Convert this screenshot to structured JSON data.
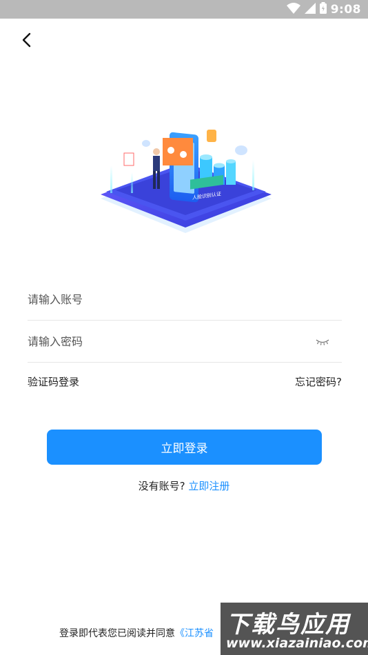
{
  "status_bar": {
    "time": "9:08",
    "icons": [
      "wifi-icon",
      "signal-icon",
      "battery-icon"
    ]
  },
  "nav": {
    "back_icon": "chevron-left-icon"
  },
  "hero": {
    "sign_text": "人脸识别认证"
  },
  "form": {
    "account_placeholder": "请输入账号",
    "password_placeholder": "请输入密码",
    "eye_icon": "eye-closed-icon"
  },
  "links": {
    "sms_login": "验证码登录",
    "forgot_password": "忘记密码?"
  },
  "login_button": "立即登录",
  "register": {
    "prompt": "没有账号?",
    "link": "立即注册"
  },
  "agreement": {
    "prefix": "登录即代表您已阅读并同意",
    "link": "《江苏省"
  },
  "watermark": {
    "title": "下载鸟应用",
    "url": "www.xiazainiao.com"
  },
  "colors": {
    "primary": "#1b90ff",
    "status_bar": "#b9b9b9"
  }
}
